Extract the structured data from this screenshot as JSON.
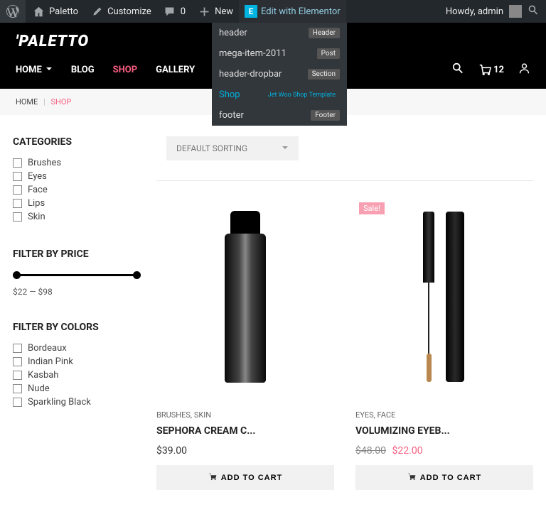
{
  "adminbar": {
    "site_name": "Paletto",
    "customize": "Customize",
    "comments_count": "0",
    "new": "New",
    "elementor": "Edit with Elementor",
    "howdy": "Howdy, admin"
  },
  "elementor_dropdown": {
    "items": [
      {
        "label": "header",
        "badge": "Header"
      },
      {
        "label": "mega-item-2011",
        "badge": "Post"
      },
      {
        "label": "header-dropbar",
        "badge": "Section"
      },
      {
        "label": "Shop",
        "badge": "Jet Woo Shop Template",
        "active": true
      },
      {
        "label": "footer",
        "badge": "Footer"
      }
    ]
  },
  "header": {
    "logo": "'PALETTO",
    "nav": {
      "home": "HOME",
      "blog": "BLOG",
      "shop": "SHOP",
      "gallery": "GALLERY"
    },
    "cart_count": "12"
  },
  "breadcrumb": {
    "home": "HOME",
    "sep": "|",
    "current": "SHOP"
  },
  "sidebar": {
    "categories": {
      "title": "CATEGORIES",
      "items": [
        "Brushes",
        "Eyes",
        "Face",
        "Lips",
        "Skin"
      ]
    },
    "price": {
      "title": "FILTER BY PRICE",
      "range": "$22 — $98"
    },
    "colors": {
      "title": "FILTER BY COLORS",
      "items": [
        "Bordeaux",
        "Indian Pink",
        "Kasbah",
        "Nude",
        "Sparkling Black"
      ]
    }
  },
  "shop": {
    "sort": "DEFAULT SORTING",
    "products": [
      {
        "cats": "BRUSHES, SKIN",
        "title": "SEPHORA CREAM C...",
        "price": "$39.00",
        "cta": "ADD TO CART"
      },
      {
        "sale": "Sale!",
        "cats": "EYES, FACE",
        "title": "VOLUMIZING EYEB...",
        "old_price": "$48.00",
        "price": "$22.00",
        "cta": "ADD TO CART"
      }
    ]
  }
}
